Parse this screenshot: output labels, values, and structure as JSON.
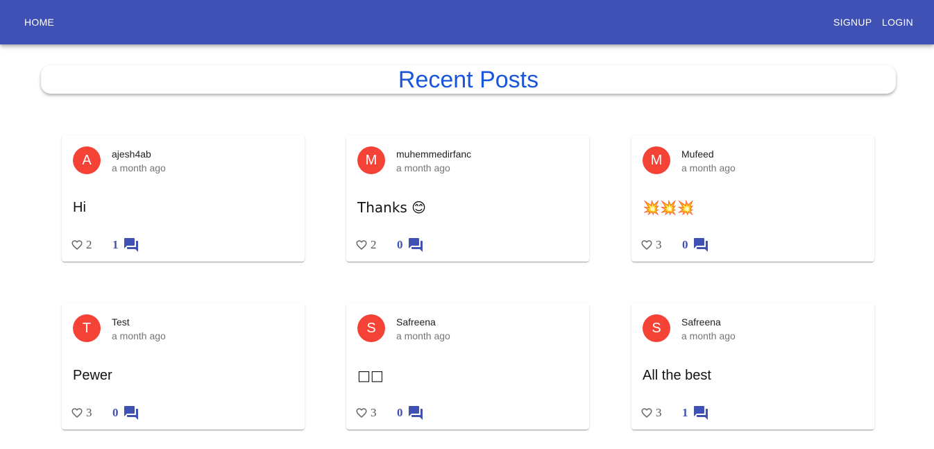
{
  "nav": {
    "home_label": "HOME",
    "signup_label": "SIGNUP",
    "login_label": "LOGIN"
  },
  "page": {
    "title": "Recent Posts"
  },
  "colors": {
    "appbar": "#3f51b5",
    "avatar": "#f44336",
    "title": "#1a56db",
    "comment_accent": "#3f51b5"
  },
  "posts": [
    {
      "avatar_letter": "A",
      "username": "ajesh4ab",
      "time": "a month ago",
      "content": "Hi",
      "likes": "2",
      "comments": "1"
    },
    {
      "avatar_letter": "M",
      "username": "muhemmedirfanc",
      "time": "a month ago",
      "content": "Thanks 😊",
      "likes": "2",
      "comments": "0"
    },
    {
      "avatar_letter": "M",
      "username": "Mufeed",
      "time": "a month ago",
      "content": "💥💥💥",
      "likes": "3",
      "comments": "0"
    },
    {
      "avatar_letter": "T",
      "username": "Test",
      "time": "a month ago",
      "content": "Pewer",
      "likes": "3",
      "comments": "0"
    },
    {
      "avatar_letter": "S",
      "username": "Safreena",
      "time": "a month ago",
      "content": "□□",
      "likes": "3",
      "comments": "0"
    },
    {
      "avatar_letter": "S",
      "username": "Safreena",
      "time": "a month ago",
      "content": "All the best",
      "likes": "3",
      "comments": "1"
    }
  ],
  "icons": {
    "like": "heart-outline-icon",
    "comment": "forum-icon"
  }
}
